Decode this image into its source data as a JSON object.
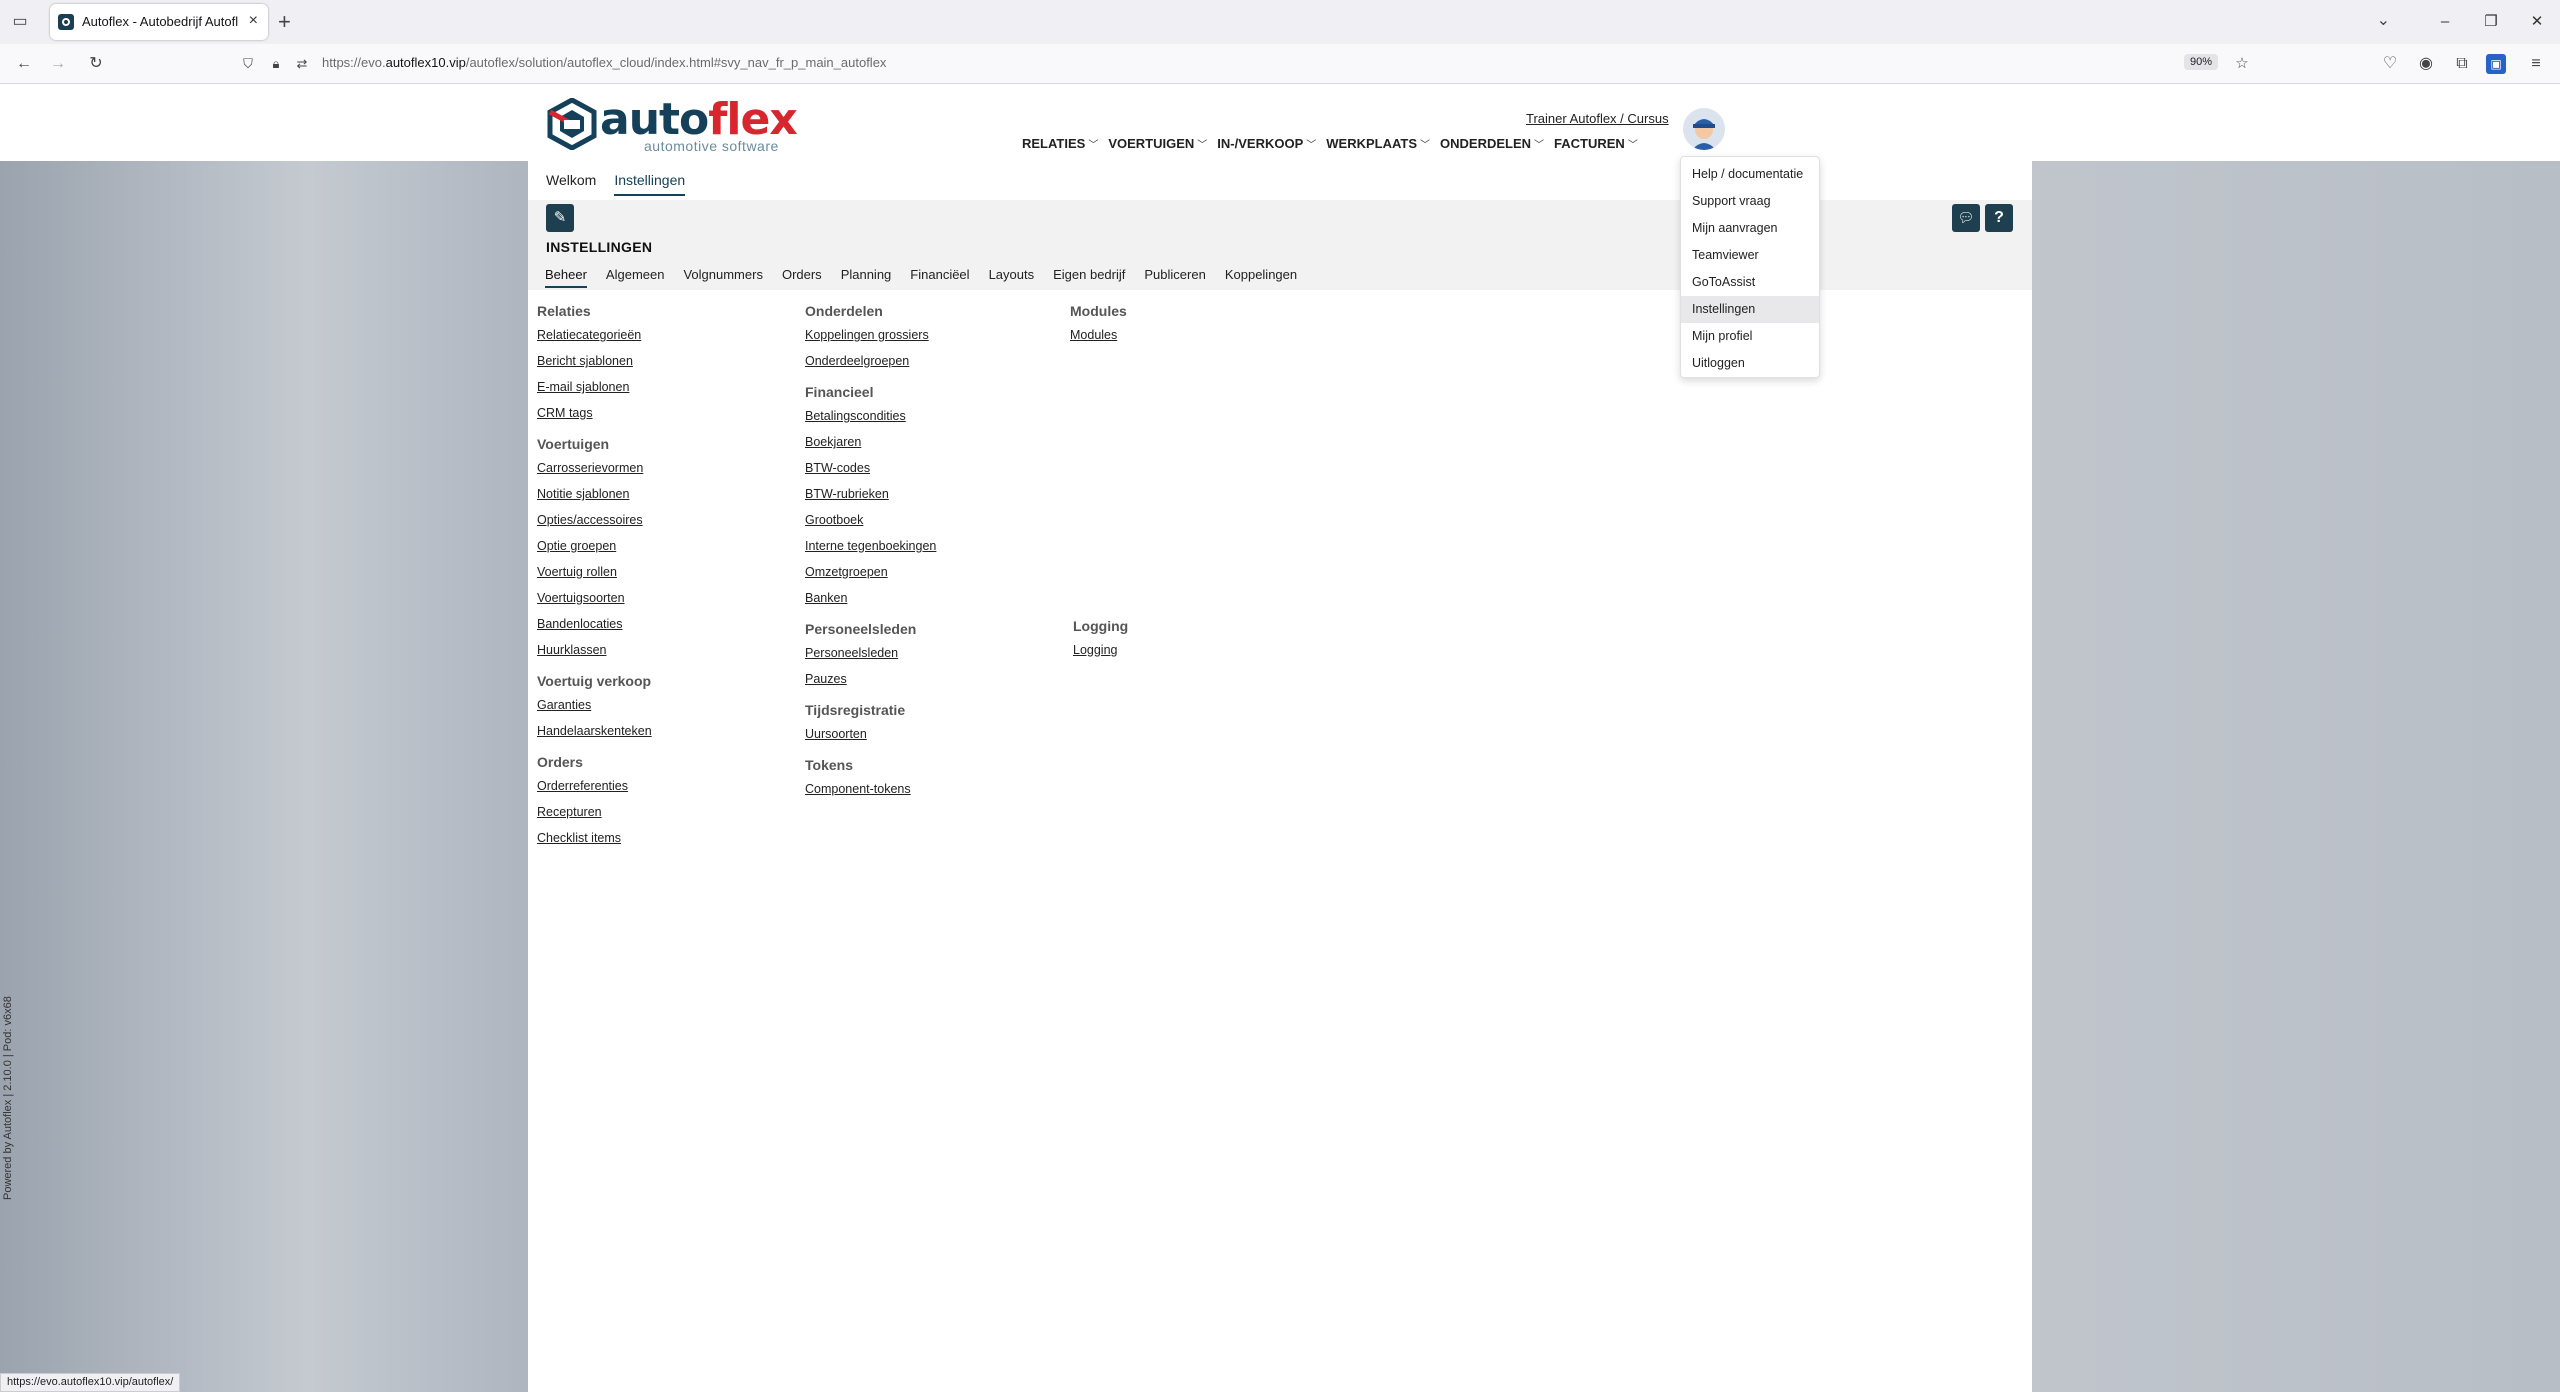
{
  "browser": {
    "tab_title": "Autoflex - Autobedrijf Autoflex",
    "url_prefix": "https://evo.",
    "url_domain": "autoflex10.vip",
    "url_suffix": "/autoflex/solution/autoflex_cloud/index.html#svy_nav_fr_p_main_autoflex",
    "zoom": "90%",
    "status_url": "https://evo.autoflex10.vip/autoflex/"
  },
  "logo": {
    "brand_a": "auto",
    "brand_b": "flex",
    "tagline": "automotive software"
  },
  "user": {
    "name": "Trainer Autoflex / Cursus"
  },
  "mainnav": [
    {
      "label": "RELATIES"
    },
    {
      "label": "VOERTUIGEN"
    },
    {
      "label": "IN-/VERKOOP"
    },
    {
      "label": "WERKPLAATS"
    },
    {
      "label": "ONDERDELEN"
    },
    {
      "label": "FACTUREN"
    }
  ],
  "subtabs": [
    {
      "label": "Welkom"
    },
    {
      "label": "Instellingen"
    }
  ],
  "page_title": "INSTELLINGEN",
  "settings_tabs": [
    "Beheer",
    "Algemeen",
    "Volgnummers",
    "Orders",
    "Planning",
    "Financiëel",
    "Layouts",
    "Eigen bedrijf",
    "Publiceren",
    "Koppelingen"
  ],
  "col1": {
    "relaties": {
      "title": "Relaties",
      "links": [
        "Relatiecategorieën",
        "Bericht sjablonen",
        "E-mail sjablonen",
        "CRM tags"
      ]
    },
    "voertuigen": {
      "title": "Voertuigen",
      "links": [
        "Carrosserievormen",
        "Notitie sjablonen",
        "Opties/accessoires",
        "Optie groepen",
        "Voertuig rollen",
        "Voertuigsoorten",
        "Bandenlocaties",
        "Huurklassen"
      ]
    },
    "verkoop": {
      "title": "Voertuig verkoop",
      "links": [
        "Garanties",
        "Handelaarskenteken"
      ]
    },
    "orders": {
      "title": "Orders",
      "links": [
        "Orderreferenties",
        "Recepturen",
        "Checklist items"
      ]
    }
  },
  "col2": {
    "onderdelen": {
      "title": "Onderdelen",
      "links": [
        "Koppelingen grossiers",
        "Onderdeelgroepen"
      ]
    },
    "financieel": {
      "title": "Financieel",
      "links": [
        "Betalingscondities",
        "Boekjaren",
        "BTW-codes",
        "BTW-rubrieken",
        "Grootboek",
        "Interne tegenboekingen",
        "Omzetgroepen",
        "Banken"
      ]
    },
    "personeel": {
      "title": "Personeelsleden",
      "links": [
        "Personeelsleden",
        "Pauzes"
      ]
    },
    "tijd": {
      "title": "Tijdsregistratie",
      "links": [
        "Uursoorten"
      ]
    },
    "tokens": {
      "title": "Tokens",
      "links": [
        "Component-tokens"
      ]
    }
  },
  "col3": {
    "modules": {
      "title": "Modules",
      "links": [
        "Modules"
      ]
    },
    "logging": {
      "title": "Logging",
      "links": [
        "Logging"
      ]
    }
  },
  "dropdown": [
    "Help / documentatie",
    "Support vraag",
    "Mijn aanvragen",
    "Teamviewer",
    "GoToAssist",
    "Instellingen",
    "Mijn profiel",
    "Uitloggen"
  ],
  "side_text": "Powered by Autoflex | 2.10.0 | Pod: v6x68",
  "colors": {
    "brand_dark": "#15405a",
    "brand_red": "#d8262e",
    "button_dark": "#1d3f50"
  }
}
